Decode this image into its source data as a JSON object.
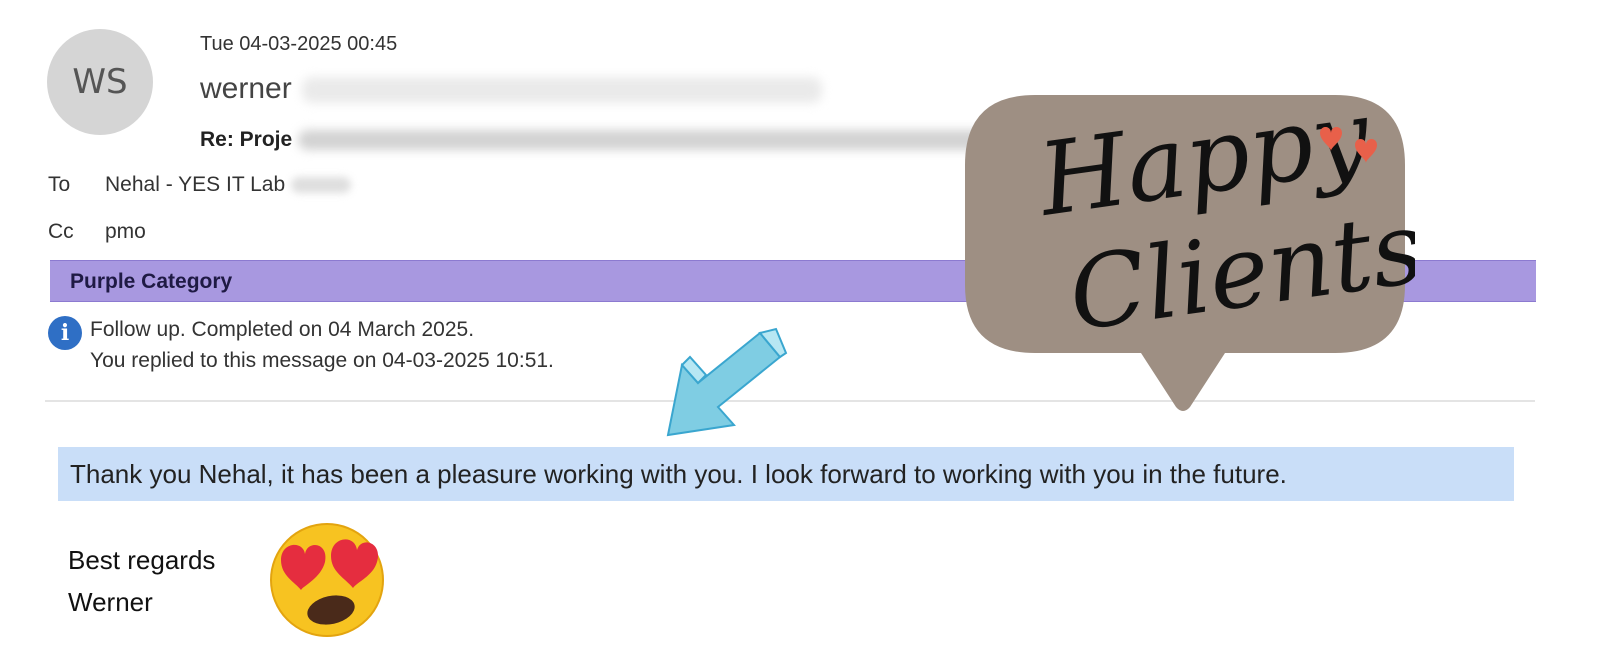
{
  "email": {
    "avatar_initials": "WS",
    "date": "Tue 04-03-2025 00:45",
    "sender_name": "werner",
    "subject_prefix": "Re: Proje",
    "to_label": "To",
    "to_value": "Nehal - YES IT Lab",
    "cc_label": "Cc",
    "cc_value": "pmo",
    "category": "Purple Category",
    "info": {
      "line1": "Follow up.  Completed on 04 March 2025.",
      "line2": "You replied to this message on 04-03-2025 10:51."
    },
    "body": "Thank you Nehal,  it has been a pleasure working with you. I look forward to working with you in the future.",
    "signature": [
      "Best regards",
      "Werner"
    ]
  },
  "overlay": {
    "line1": "Happy",
    "line2": "Clients!"
  },
  "colors": {
    "category_bar": "#a898e0",
    "highlight": "#c9def8",
    "bubble": "#9e8f83",
    "arrow": "#9ad9ea",
    "info_icon": "#2f6fc5",
    "hearts": "#e8604a"
  },
  "icons": {
    "info": "info-icon",
    "arrow": "arrow-icon",
    "emoji": "heart-eyes-emoji-icon",
    "bubble": "speech-bubble"
  }
}
